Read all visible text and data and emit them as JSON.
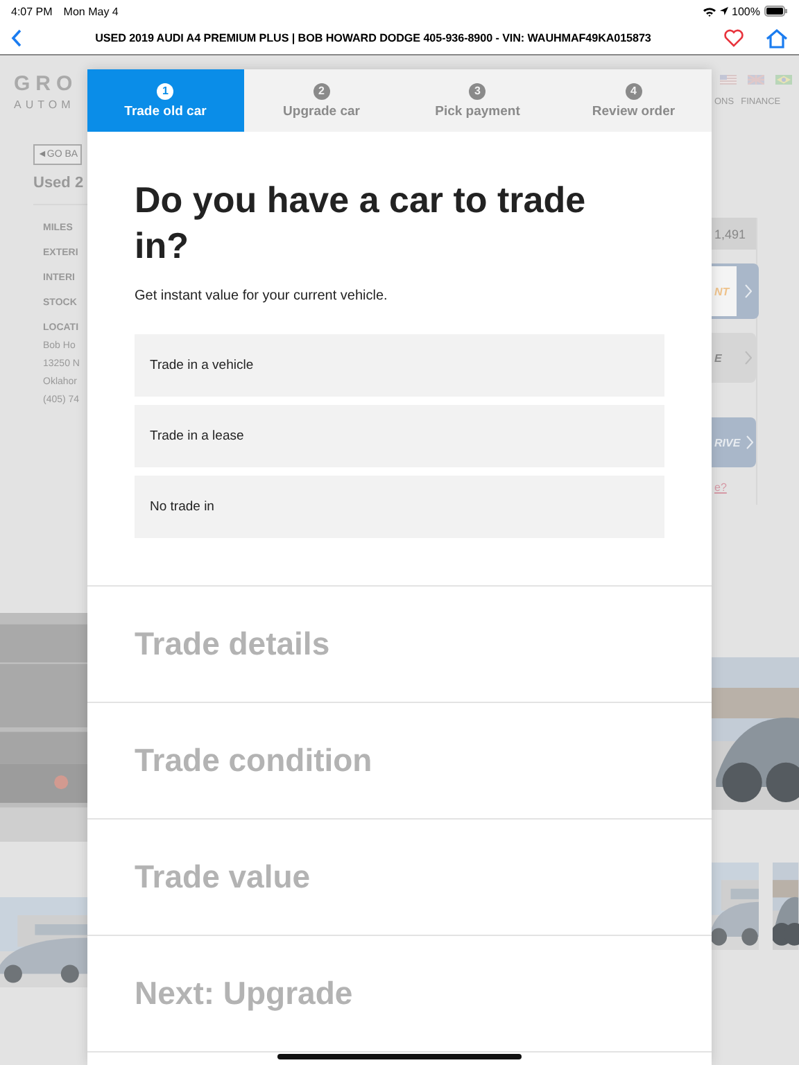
{
  "status_bar": {
    "time": "4:07 PM",
    "date": "Mon May 4",
    "battery": "100%"
  },
  "nav_bar": {
    "title": "USED 2019 AUDI A4 PREMIUM PLUS | BOB HOWARD DODGE 405-936-8900 - VIN: WAUHMAF49KA015873",
    "favorite": false
  },
  "background_page": {
    "logo_top": "GRO",
    "logo_bottom": "AUTOM",
    "back_link": "◄GO BA",
    "heading": "Used 2",
    "specs": [
      "MILES",
      "EXTERI",
      "INTERI",
      "STOCK",
      "LOCATI"
    ],
    "address": [
      "Bob Ho",
      "13250 N",
      "Oklahor",
      "(405) 74"
    ],
    "nav_links": [
      "ONS",
      "FINANCE"
    ],
    "price": "1,491",
    "buttons": [
      {
        "label": "NT",
        "kind": "orange"
      },
      {
        "label": "E",
        "kind": "gray"
      },
      {
        "label": "RIVE",
        "kind": "blue"
      }
    ],
    "link": "e?"
  },
  "wizard": {
    "steps": [
      {
        "number": "1",
        "label": "Trade old car",
        "selected": true
      },
      {
        "number": "2",
        "label": "Upgrade car",
        "selected": false
      },
      {
        "number": "3",
        "label": "Pick payment",
        "selected": false
      },
      {
        "number": "4",
        "label": "Review order",
        "selected": false
      }
    ],
    "title": "Do you have a car to trade in?",
    "subtitle": "Get instant value for your current vehicle.",
    "options": [
      "Trade in a vehicle",
      "Trade in a lease",
      "No trade in"
    ],
    "sections": [
      "Trade details",
      "Trade condition",
      "Trade value",
      "Next: Upgrade"
    ]
  }
}
